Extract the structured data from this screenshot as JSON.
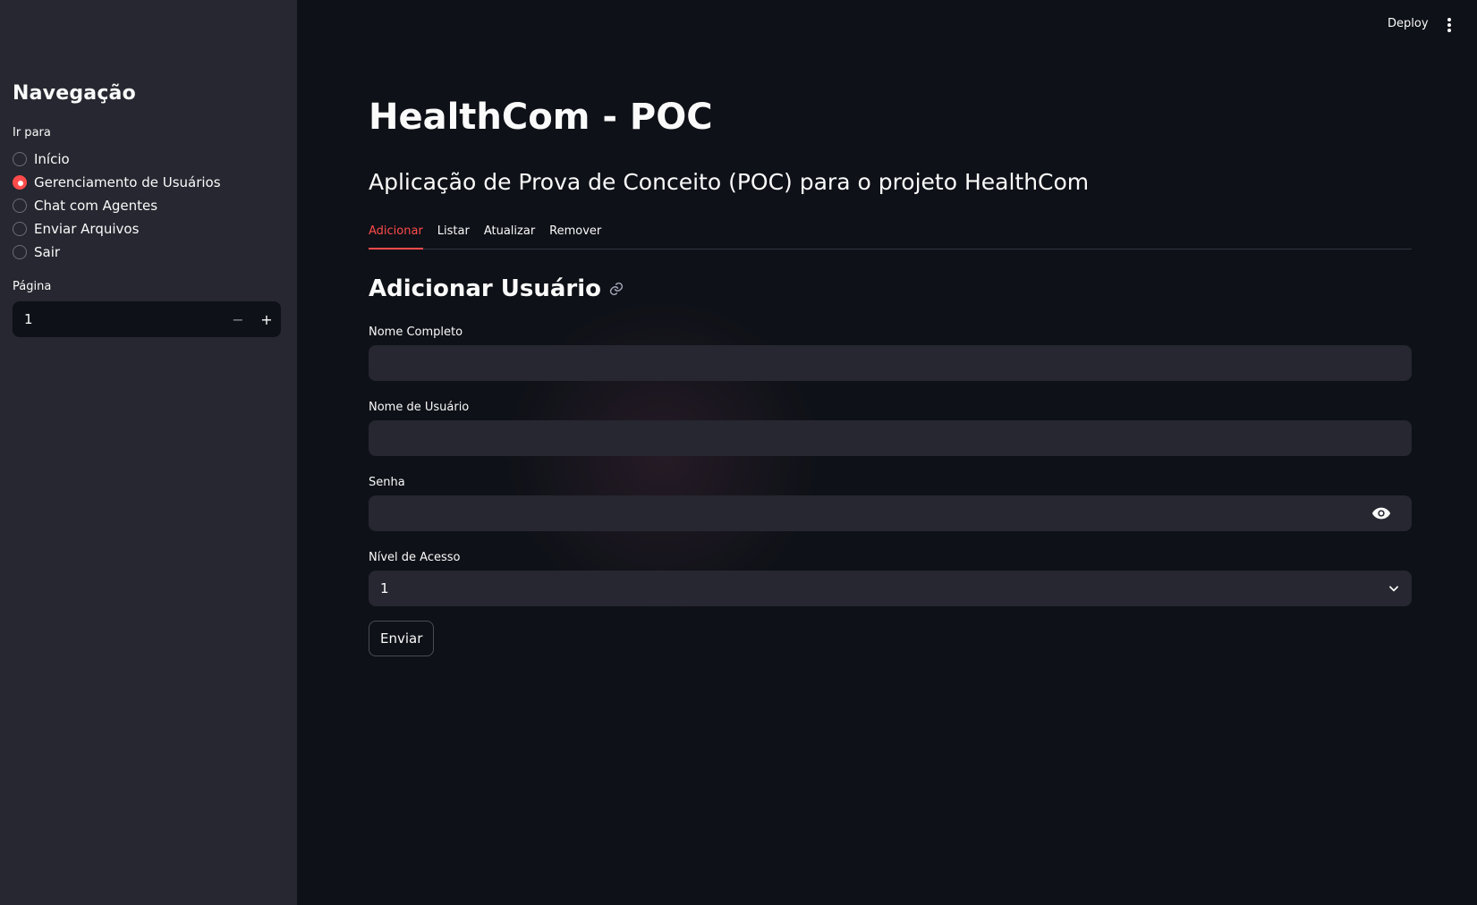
{
  "header": {
    "deploy_label": "Deploy",
    "menu_icon": "kebab-menu-icon"
  },
  "sidebar": {
    "title": "Navegação",
    "radio_group_label": "Ir para",
    "items": [
      {
        "label": "Início",
        "checked": false
      },
      {
        "label": "Gerenciamento de Usuários",
        "checked": true
      },
      {
        "label": "Chat com Agentes",
        "checked": false
      },
      {
        "label": "Enviar Arquivos",
        "checked": false
      },
      {
        "label": "Sair",
        "checked": false
      }
    ],
    "page_input": {
      "label": "Página",
      "value": "1",
      "decrement": "−",
      "increment": "+"
    }
  },
  "main": {
    "title": "HealthCom - POC",
    "subtitle": "Aplicação de Prova de Conceito (POC) para o projeto HealthCom",
    "tabs": [
      {
        "label": "Adicionar",
        "active": true
      },
      {
        "label": "Listar",
        "active": false
      },
      {
        "label": "Atualizar",
        "active": false
      },
      {
        "label": "Remover",
        "active": false
      }
    ],
    "form": {
      "section_title": "Adicionar Usuário",
      "full_name_label": "Nome Completo",
      "full_name_value": "",
      "username_label": "Nome de Usuário",
      "username_value": "",
      "password_label": "Senha",
      "password_value": "",
      "access_level_label": "Nível de Acesso",
      "access_level_value": "1",
      "submit_label": "Enviar"
    }
  },
  "colors": {
    "accent": "#ff4b4b",
    "background": "#0e1117",
    "sidebar_background": "#262730",
    "input_background": "#262730",
    "text": "#fafafa"
  }
}
